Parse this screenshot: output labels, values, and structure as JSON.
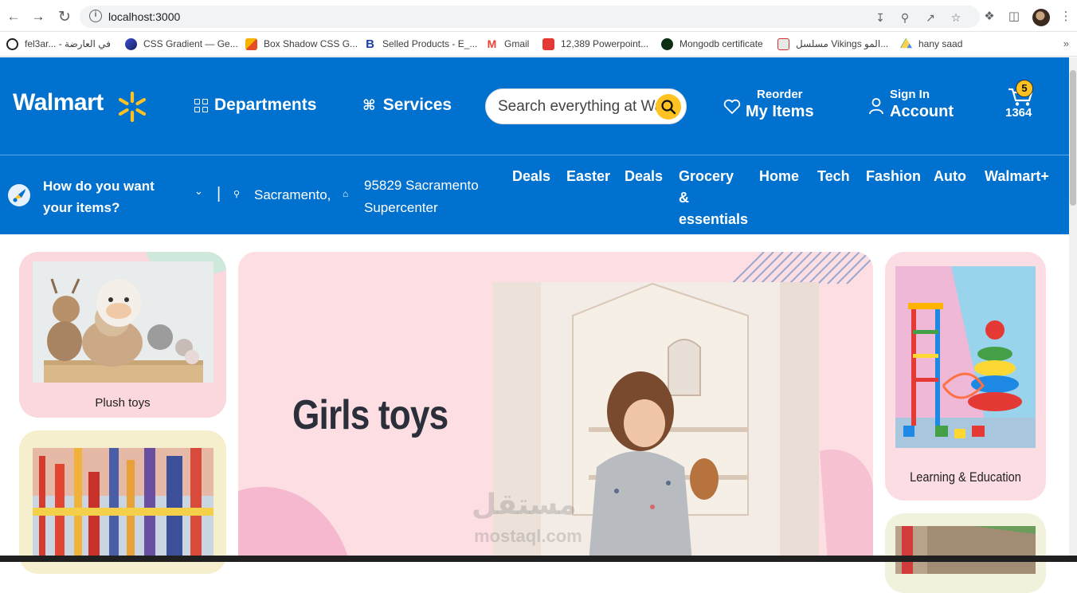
{
  "browser": {
    "url": "localhost:3000",
    "bookmarks": [
      {
        "label": "fel3ar... - في العارضة",
        "color": "#222222"
      },
      {
        "label": "CSS Gradient — Ge...",
        "color": "#2d3b8f"
      },
      {
        "label": "Box Shadow CSS G...",
        "color": "#e44d26"
      },
      {
        "label": "Selled Products - E_...",
        "color": "#1c3faa"
      },
      {
        "label": "Gmail",
        "color": "#ea4335"
      },
      {
        "label": "12,389 Powerpoint...",
        "color": "#e53935"
      },
      {
        "label": "Mongodb certificate",
        "color": "#0b2e14"
      },
      {
        "label": "مسلسل Vikings المو...",
        "color": "#d8d8d8"
      },
      {
        "label": "hany saad",
        "color": "#1fa463"
      }
    ]
  },
  "header": {
    "logo": "Walmart",
    "departments": "Departments",
    "services": "Services",
    "search_placeholder": "Search everything at Walmart online and in store",
    "reorder_small": "Reorder",
    "reorder_big": "My Items",
    "signin_small": "Sign In",
    "signin_big": "Account",
    "cart_count": "5",
    "cart_total": "1364",
    "brand_color": "#0071ce",
    "accent_color": "#ffc220"
  },
  "subheader": {
    "how_line1": "How do you want",
    "how_line2": "your items?",
    "city": "Sacramento,",
    "store_line1": "95829 Sacramento",
    "store_line2": "Supercenter",
    "categories": [
      "Deals",
      "Easter",
      "Deals",
      "Grocery",
      "&",
      "essentials",
      "Home",
      "Tech",
      "Fashion",
      "Auto",
      "Walmart+"
    ]
  },
  "main": {
    "left_card_1": "Plush toys",
    "banner_title": "Girls toys",
    "right_card_1": "Learning & Education",
    "watermark": "مستقل",
    "watermark_latin": "mostaql.com"
  }
}
